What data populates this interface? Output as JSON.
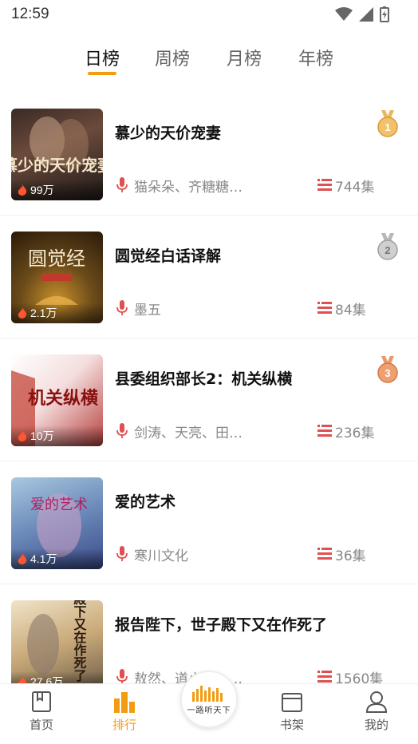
{
  "status_bar": {
    "time": "12:59"
  },
  "tabs": [
    {
      "label": "日榜",
      "active": true
    },
    {
      "label": "周榜",
      "active": false
    },
    {
      "label": "月榜",
      "active": false
    },
    {
      "label": "年榜",
      "active": false
    }
  ],
  "accent_color": "#f39c12",
  "items": [
    {
      "title": "慕少的天价宠妻",
      "plays": "99万",
      "author": "猫朵朵、齐糖糖…",
      "episodes": "744集",
      "rank": "1",
      "cover_text": "慕少的天价宠妻"
    },
    {
      "title": "圆觉经白话译解",
      "plays": "2.1万",
      "author": "墨五",
      "episodes": "84集",
      "rank": "2",
      "cover_text": "圆觉经"
    },
    {
      "title": "县委组织部长2：机关纵横",
      "plays": "10万",
      "author": "剑涛、天亮、田…",
      "episodes": "236集",
      "rank": "3",
      "cover_text": "机关纵横"
    },
    {
      "title": "爱的艺术",
      "plays": "4.1万",
      "author": "寒川文化",
      "episodes": "36集",
      "rank": "",
      "cover_text": "爱的艺术"
    },
    {
      "title": "报告陛下，世子殿下又在作死了",
      "plays": "27.6万",
      "author": "敖然、道小司、…",
      "episodes": "1560集",
      "rank": "",
      "cover_text": "世子殿下又在作死了"
    }
  ],
  "bottom_nav": {
    "home": "首页",
    "ranking": "排行",
    "logo": "一路听天下",
    "shelf": "书架",
    "mine": "我的"
  }
}
